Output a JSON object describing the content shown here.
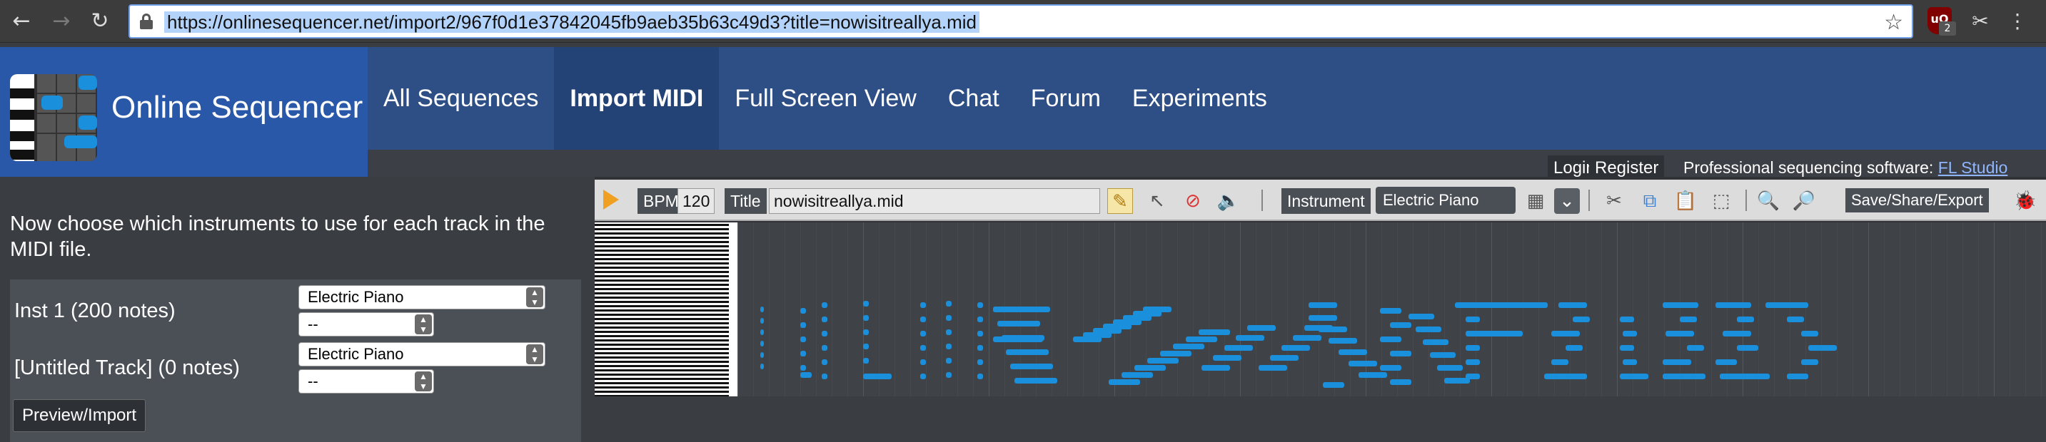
{
  "browser": {
    "url": "https://onlinesequencer.net/import2/967f0d1e37842045fb9aeb35b63c49d3?title=nowisitreallya.mid",
    "extension_badge": "2",
    "icons": [
      "back-arrow-icon",
      "forward-arrow-icon",
      "reload-icon",
      "lock-icon",
      "star-icon",
      "ublock-icon",
      "scissors-extension-icon",
      "kebab-menu-icon"
    ]
  },
  "site": {
    "brand": "Online Sequencer",
    "nav": [
      {
        "label": "All Sequences"
      },
      {
        "label": "Import MIDI",
        "active": true
      },
      {
        "label": "Full Screen View"
      },
      {
        "label": "Chat"
      },
      {
        "label": "Forum"
      },
      {
        "label": "Experiments"
      }
    ],
    "login": "Login",
    "register": "Register",
    "promo_text": "Professional sequencing software:",
    "promo_link": "FL Studio"
  },
  "import_panel": {
    "instructions": "Now choose which instruments to use for each track in the MIDI file.",
    "tracks": [
      {
        "name": "Inst 1 (200 notes)",
        "instrument": "Electric Piano",
        "option": "--"
      },
      {
        "name": "[Untitled Track] (0 notes)",
        "instrument": "Electric Piano",
        "option": "--"
      }
    ],
    "preview_button": "Preview/Import"
  },
  "sequencer": {
    "bpm_label": "BPM",
    "bpm_value": "120",
    "title_label": "Title",
    "title_value": "nowisitreallya.mid",
    "instrument_label": "Instrument",
    "instrument_value": "Electric Piano",
    "save_button": "Save/Share/Export",
    "colors": {
      "note": "#1a8fdc",
      "toolbar": "#dcdcdc",
      "header": "#2d4f85",
      "brand_bg": "#2a58a8"
    }
  }
}
